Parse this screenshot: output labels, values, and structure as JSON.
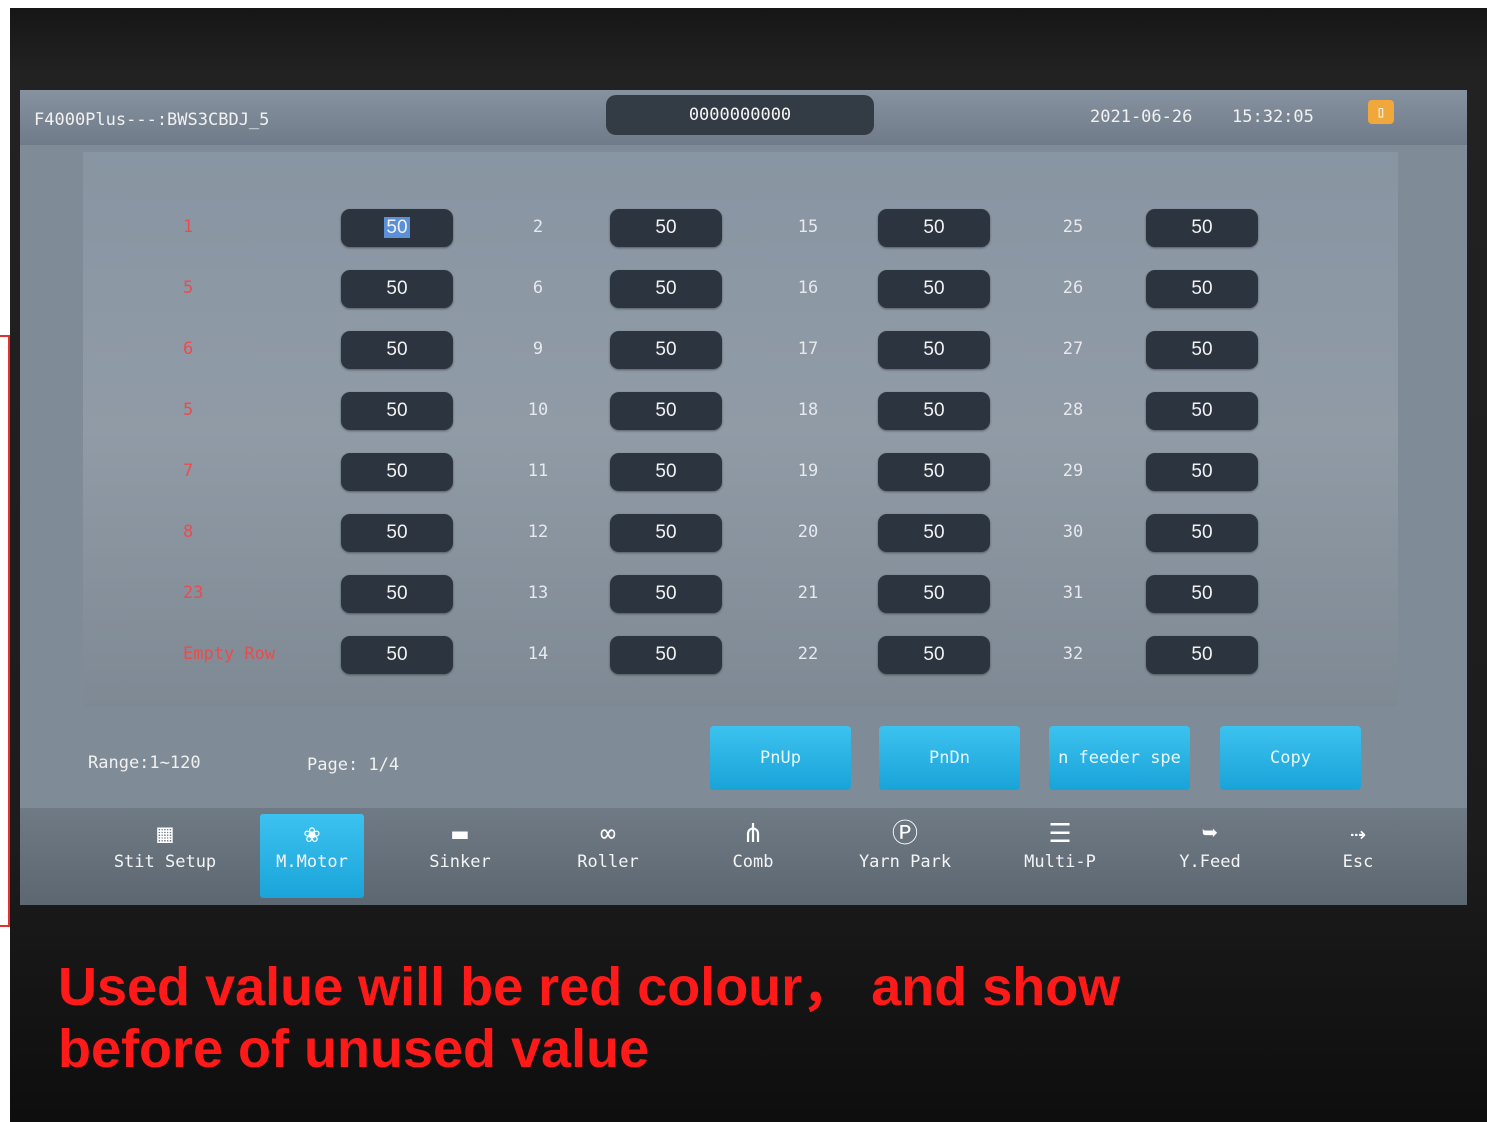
{
  "header": {
    "title": "F4000Plus---:BWS3CBDJ_5",
    "counter": "0000000000",
    "date": "2021-06-26",
    "time": "15:32:05",
    "icon": "folder-icon"
  },
  "grid": {
    "columns": [
      {
        "labels": [
          "1",
          "5",
          "6",
          "5",
          "7",
          "8",
          "23",
          "Empty Row"
        ],
        "values": [
          "50",
          "50",
          "50",
          "50",
          "50",
          "50",
          "50",
          "50"
        ],
        "label_color": "#ea4c4c"
      },
      {
        "labels": [
          "2",
          "6",
          "9",
          "10",
          "11",
          "12",
          "13",
          "14"
        ],
        "values": [
          "50",
          "50",
          "50",
          "50",
          "50",
          "50",
          "50",
          "50"
        ]
      },
      {
        "labels": [
          "15",
          "16",
          "17",
          "18",
          "19",
          "20",
          "21",
          "22"
        ],
        "values": [
          "50",
          "50",
          "50",
          "50",
          "50",
          "50",
          "50",
          "50"
        ]
      },
      {
        "labels": [
          "25",
          "26",
          "27",
          "28",
          "29",
          "30",
          "31",
          "32"
        ],
        "values": [
          "50",
          "50",
          "50",
          "50",
          "50",
          "50",
          "50",
          "50"
        ]
      }
    ]
  },
  "footer": {
    "range": "Range:1~120",
    "page": "Page: 1/4",
    "buttons": [
      "PnUp",
      "PnDn",
      "n feeder spe",
      "Copy"
    ]
  },
  "toolbar": {
    "items": [
      {
        "label": "Stit Setup",
        "icon": "grid-icon"
      },
      {
        "label": "M.Motor",
        "icon": "motor-icon",
        "active": true
      },
      {
        "label": "Sinker",
        "icon": "sinker-icon"
      },
      {
        "label": "Roller",
        "icon": "roller-icon"
      },
      {
        "label": "Comb",
        "icon": "comb-icon"
      },
      {
        "label": "Yarn Park",
        "icon": "yarn-park-icon"
      },
      {
        "label": "Multi-P",
        "icon": "list-add-icon"
      },
      {
        "label": "Y.Feed",
        "icon": "feed-icon"
      },
      {
        "label": "Esc",
        "icon": "exit-icon"
      }
    ]
  },
  "annotation": {
    "line1": "Used  value will be red  colour，  and show",
    "line2": "before of unused value",
    "color": "#ff1a1a"
  }
}
